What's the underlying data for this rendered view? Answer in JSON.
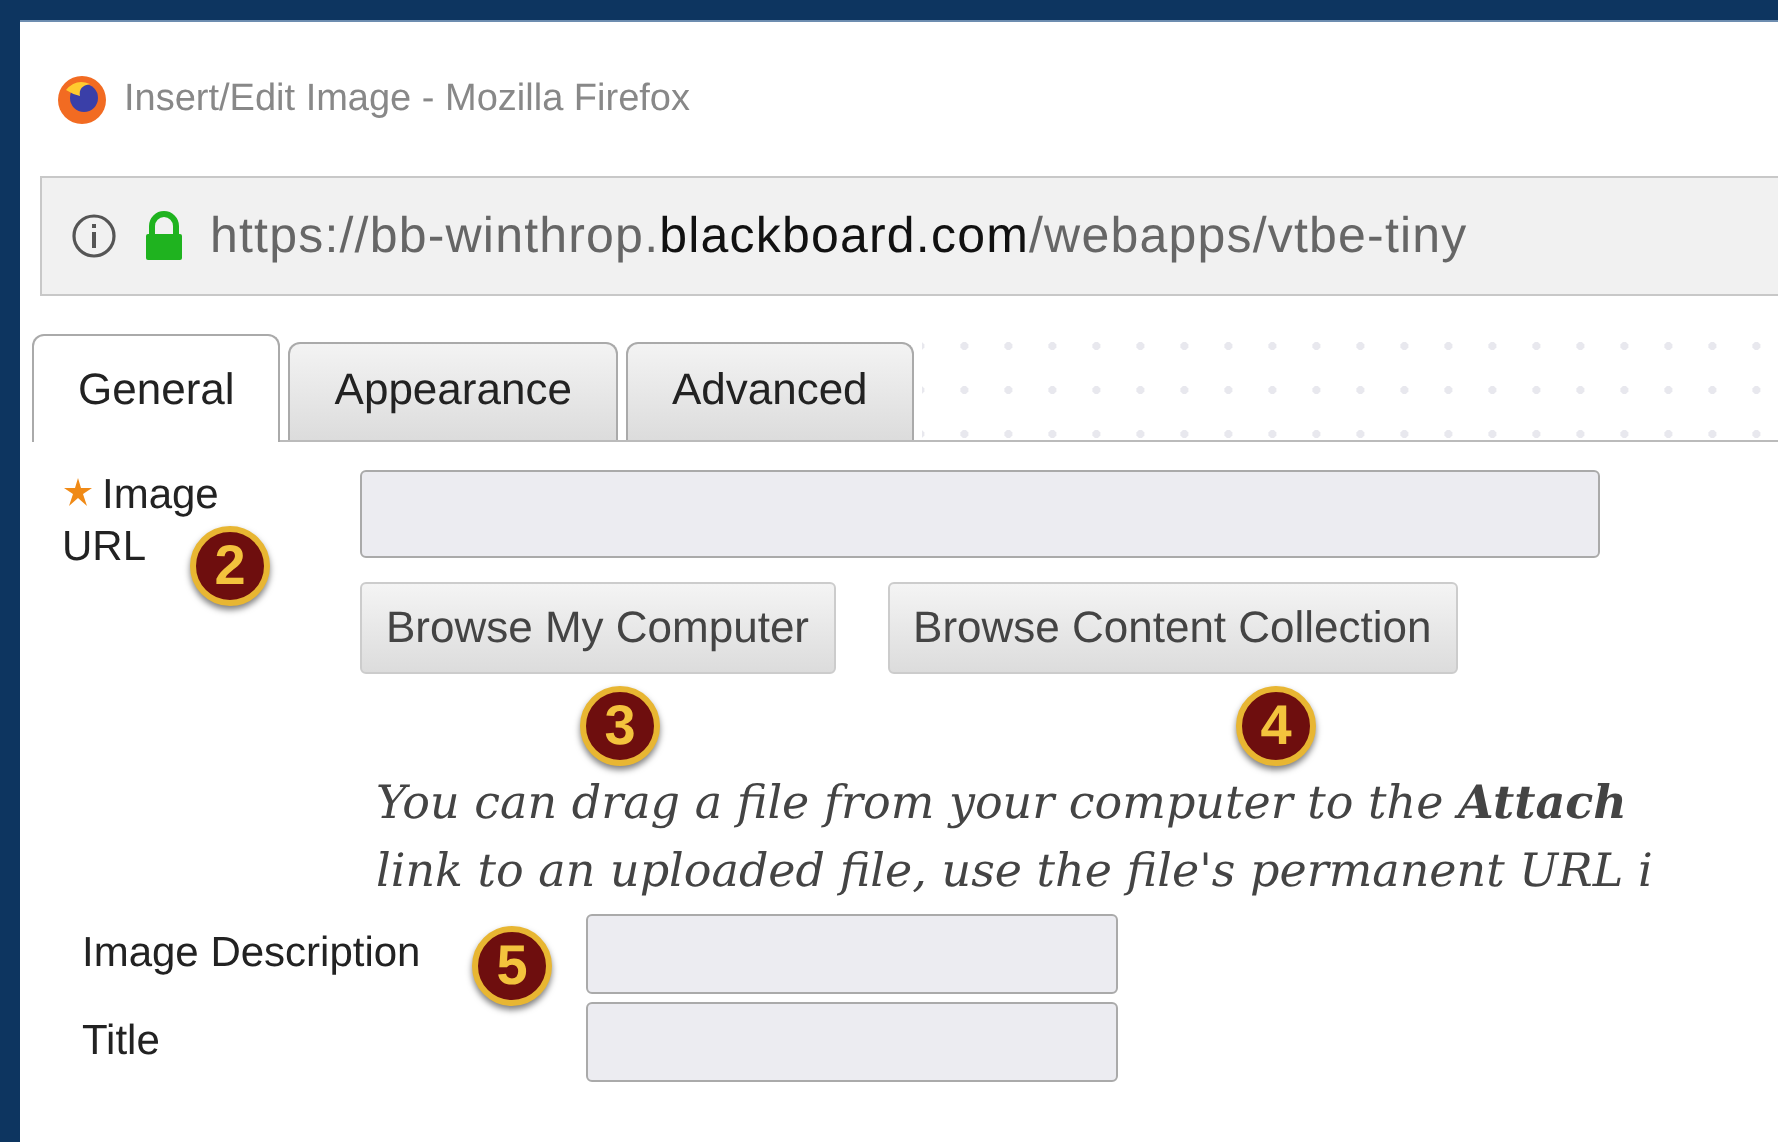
{
  "window": {
    "title": "Insert/Edit Image - Mozilla Firefox"
  },
  "address_bar": {
    "url_prefix": "https://bb-winthrop.",
    "url_domain": "blackboard.com",
    "url_path": "/webapps/vtbe-tiny"
  },
  "tabs": [
    {
      "label": "General",
      "selected": true
    },
    {
      "label": "Appearance",
      "selected": false
    },
    {
      "label": "Advanced",
      "selected": false
    }
  ],
  "form": {
    "image_url": {
      "label": "Image URL",
      "required": true
    },
    "buttons": [
      "Browse My Computer",
      "Browse Content Collection"
    ],
    "help_text": [
      "You can drag a file from your computer to the **Attach**",
      "link to an uploaded file, use the file's permanent URL i"
    ],
    "fields": [
      {
        "label": "Image Description"
      },
      {
        "label": "Title"
      }
    ]
  },
  "callouts": [
    {
      "number": "2"
    },
    {
      "number": "3"
    },
    {
      "number": "4"
    },
    {
      "number": "5"
    }
  ]
}
